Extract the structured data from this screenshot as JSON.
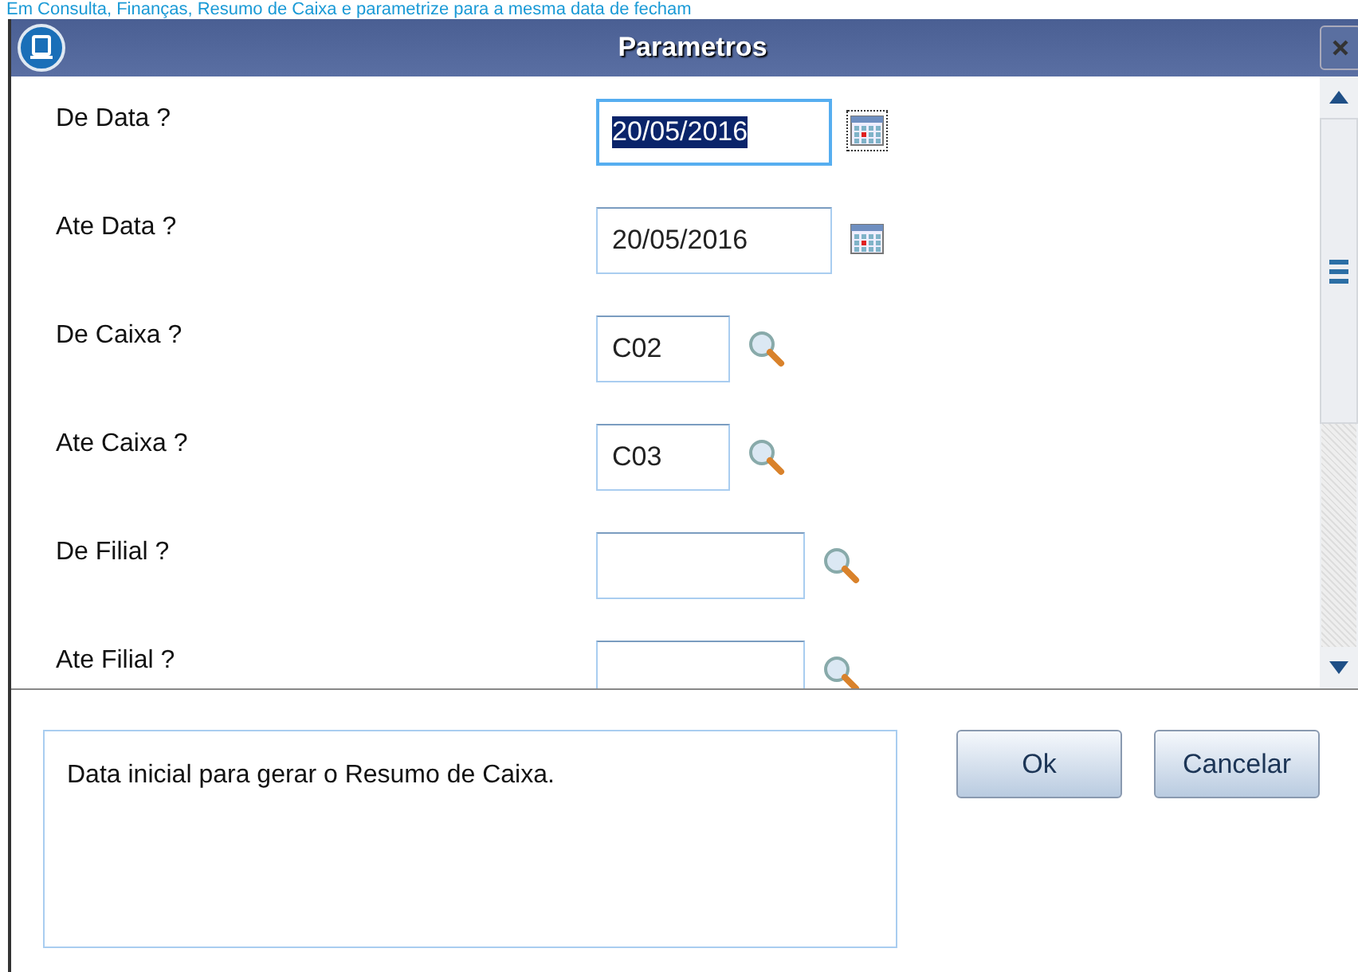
{
  "top_link": "Em Consulta, Finanças, Resumo de Caixa e parametrize para a mesma data de fecham",
  "window": {
    "title": "Parametros"
  },
  "params": [
    {
      "label": "De Data ?",
      "kind": "date",
      "value": "20/05/2016",
      "selected": true
    },
    {
      "label": "Ate Data ?",
      "kind": "date",
      "value": "20/05/2016",
      "selected": false
    },
    {
      "label": "De Caixa ?",
      "kind": "lookup",
      "value": "C02",
      "selected": false
    },
    {
      "label": "Ate Caixa ?",
      "kind": "lookup",
      "value": "C03",
      "selected": false
    },
    {
      "label": "De Filial ?",
      "kind": "lookup-wide",
      "selected": false
    },
    {
      "label": "Ate Filial ?",
      "kind": "lookup-wide",
      "selected": false
    }
  ],
  "help_text": "Data inicial para gerar o Resumo de Caixa.",
  "buttons": [
    "Ok",
    "Cancelar"
  ]
}
